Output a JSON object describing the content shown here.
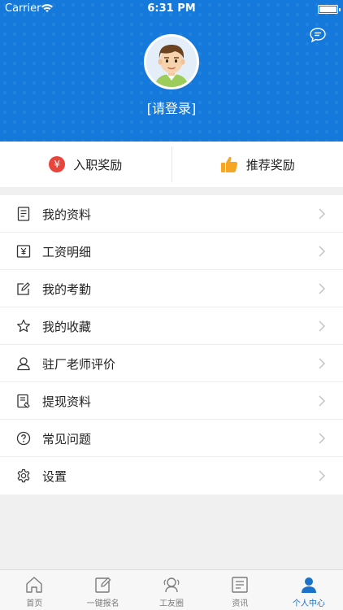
{
  "status_bar": {
    "carrier": "Carrier",
    "time": "6:31 PM"
  },
  "profile": {
    "login_text": "[请登录]"
  },
  "rewards": [
    {
      "label": "入职奖励",
      "icon": "yen-badge-icon",
      "badge_text": "¥",
      "color": "#e8453c"
    },
    {
      "label": "推荐奖励",
      "icon": "thumbs-up-icon",
      "color": "#f5a623"
    }
  ],
  "menu": {
    "items": [
      {
        "label": "我的资料",
        "icon": "document-icon"
      },
      {
        "label": "工资明细",
        "icon": "salary-icon"
      },
      {
        "label": "我的考勤",
        "icon": "edit-icon"
      },
      {
        "label": "我的收藏",
        "icon": "star-icon"
      },
      {
        "label": "驻厂老师评价",
        "icon": "person-icon"
      },
      {
        "label": "提现资料",
        "icon": "withdraw-doc-icon"
      },
      {
        "label": "常见问题",
        "icon": "question-icon"
      },
      {
        "label": "设置",
        "icon": "gear-icon"
      }
    ]
  },
  "tabbar": {
    "tabs": [
      {
        "label": "首页",
        "icon": "home-icon",
        "active": false
      },
      {
        "label": "一键报名",
        "icon": "signup-icon",
        "active": false
      },
      {
        "label": "工友圈",
        "icon": "circle-icon",
        "active": false
      },
      {
        "label": "资讯",
        "icon": "news-icon",
        "active": false
      },
      {
        "label": "个人中心",
        "icon": "user-icon",
        "active": true
      }
    ]
  },
  "colors": {
    "header_bg": "#1479da",
    "active_tab": "#1a72c9",
    "badge_red": "#e8453c",
    "thumb_orange": "#f5a623"
  }
}
